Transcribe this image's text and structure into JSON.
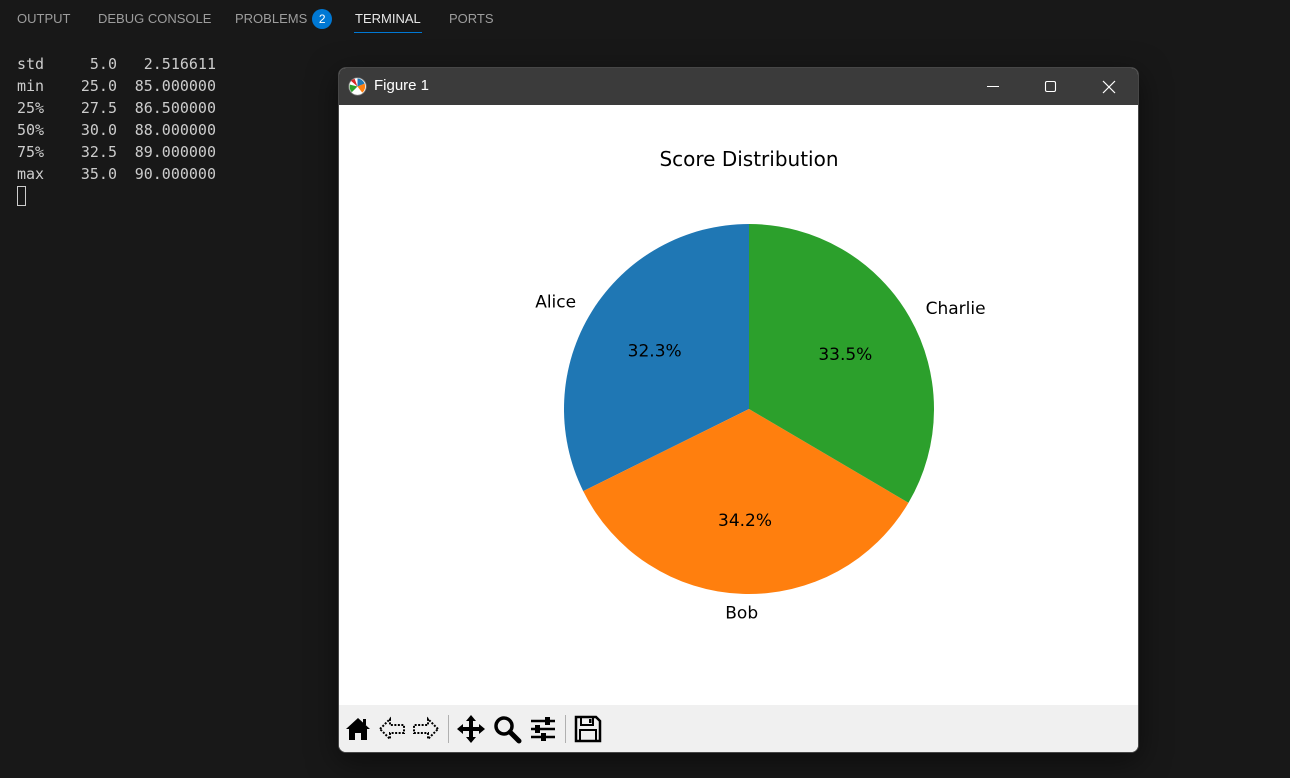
{
  "panel": {
    "tabs": [
      {
        "label": "OUTPUT"
      },
      {
        "label": "DEBUG CONSOLE"
      },
      {
        "label": "PROBLEMS",
        "badge": "2"
      },
      {
        "label": "TERMINAL"
      },
      {
        "label": "PORTS"
      }
    ],
    "active_tab": "TERMINAL"
  },
  "terminal": {
    "rows": [
      {
        "stat": "std",
        "age": "5.0",
        "score": "2.516611"
      },
      {
        "stat": "min",
        "age": "25.0",
        "score": "85.000000"
      },
      {
        "stat": "25%",
        "age": "27.5",
        "score": "86.500000"
      },
      {
        "stat": "50%",
        "age": "30.0",
        "score": "88.000000"
      },
      {
        "stat": "75%",
        "age": "32.5",
        "score": "89.000000"
      },
      {
        "stat": "max",
        "age": "35.0",
        "score": "90.000000"
      }
    ]
  },
  "window": {
    "title": "Figure 1",
    "icons": {
      "app": "matplotlib-icon",
      "minimize": "minimize-icon",
      "maximize": "maximize-icon",
      "close": "close-icon"
    }
  },
  "toolbar": {
    "icons": [
      "home-icon",
      "back-arrow-icon",
      "forward-arrow-icon",
      "pan-icon",
      "zoom-icon",
      "configure-subplots-icon",
      "save-icon"
    ]
  },
  "chart_data": {
    "type": "pie",
    "title": "Score Distribution",
    "labels": [
      "Alice",
      "Bob",
      "Charlie"
    ],
    "values": [
      85,
      90,
      88
    ],
    "percent_labels": [
      "32.3%",
      "34.2%",
      "33.5%"
    ],
    "colors": [
      "#1f77b4",
      "#ff7f0e",
      "#2ca02c"
    ],
    "start_angle": 90,
    "direction": "counterclockwise"
  }
}
